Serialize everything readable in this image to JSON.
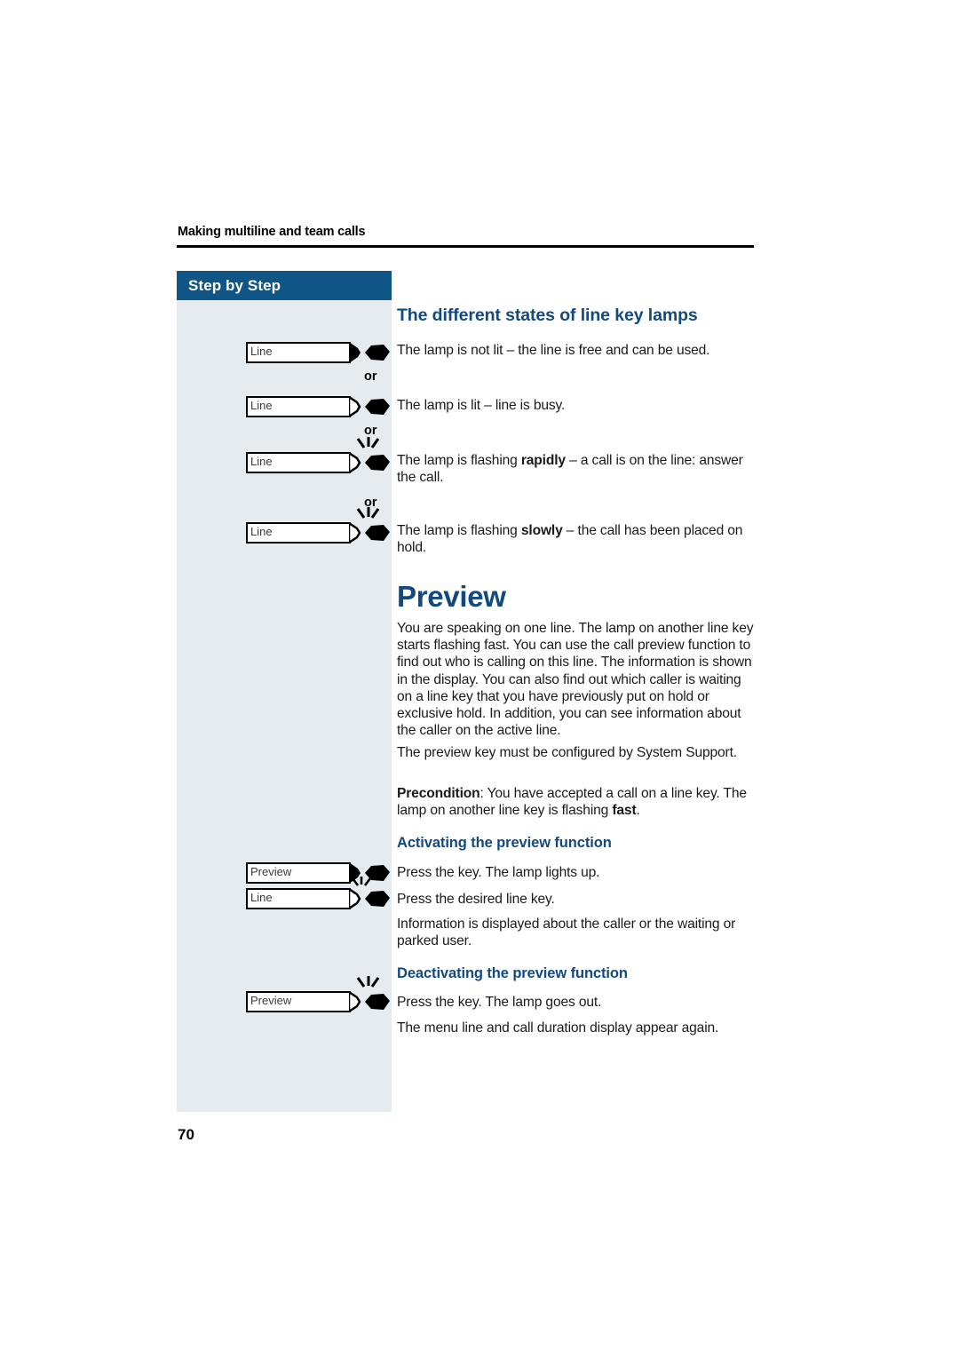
{
  "page": {
    "running_head": "Making multiline and team calls",
    "page_number": "70",
    "colors": {
      "banner": "#0f5586",
      "sidebar": "#e6ebf0",
      "heading": "#12497e",
      "body_text": "#1a1a1a"
    }
  },
  "sidebar": {
    "banner_label": "Step by Step",
    "or_labels": [
      "or",
      "or",
      "or"
    ],
    "keys": [
      {
        "label": "Line",
        "tip": "filled",
        "lamp": "filled",
        "flashing": false
      },
      {
        "label": "Line",
        "tip": "unfilled",
        "lamp": "filled",
        "flashing": false
      },
      {
        "label": "Line",
        "tip": "unfilled",
        "lamp": "filled",
        "flashing": true
      },
      {
        "label": "Line",
        "tip": "unfilled",
        "lamp": "filled",
        "flashing": true
      },
      {
        "label": "Preview",
        "tip": "filled",
        "lamp": "filled",
        "flashing": false
      },
      {
        "label": "Line",
        "tip": "unfilled",
        "lamp": "filled",
        "flashing": true
      },
      {
        "label": "Preview",
        "tip": "unfilled",
        "lamp": "filled",
        "flashing": true
      }
    ]
  },
  "main": {
    "section_title": "The different states of line key lamps",
    "lamp_states": [
      {
        "pre": "The lamp is not lit ",
        "em": "",
        "post": "– the line is free and can be used."
      },
      {
        "pre": "The lamp is lit – line is busy.",
        "em": "",
        "post": ""
      },
      {
        "pre": "The lamp is flashing ",
        "em": "rapidly",
        "post": " – a call is on the line: answer the call."
      },
      {
        "pre": "The lamp is flashing ",
        "em": "slowly",
        "post": " – the call has been placed on hold."
      }
    ],
    "chapter_title": "Preview",
    "intro_paragraph": "You are speaking on one line. The lamp on another line key starts flashing fast. You can use the call preview function to find out who is calling on this line. The information is shown in the display. You can also find out which caller is waiting on a line key that you have previously put on hold or exclusive hold. In addition, you can see information about the caller on the active line.",
    "config_paragraph": "The preview key must be configured by System Support.",
    "precondition": {
      "label": "Precondition",
      "pre": ": You have accepted a call on a line key. The lamp on another line key is flashing ",
      "em": "fast",
      "post": "."
    },
    "activating": {
      "title": "Activating the preview function",
      "step_1": "Press the key. The lamp lights up.",
      "step_2": "Press the desired line key.",
      "result": "Information is displayed about the caller or the waiting or parked user."
    },
    "deactivating": {
      "title": "Deactivating the preview function",
      "step_1": "Press the key. The lamp goes out.",
      "result": "The menu line and call duration display appear again."
    }
  }
}
